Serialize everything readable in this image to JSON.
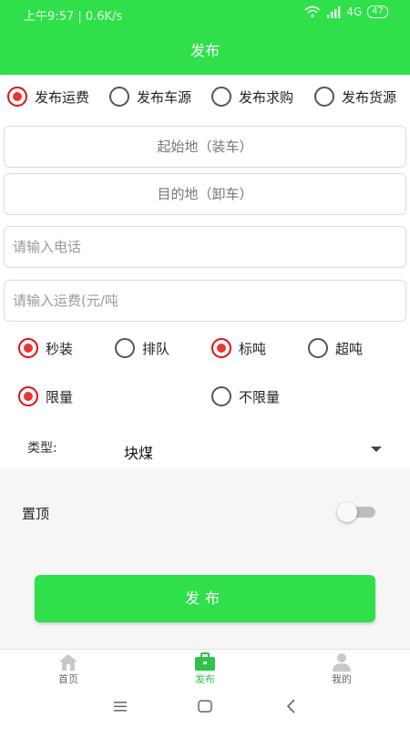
{
  "status": {
    "time_speed": "上午9:57 | 0.6K/s",
    "network": "4G",
    "battery": "47"
  },
  "header": {
    "title": "发布"
  },
  "publish_types": [
    {
      "label": "发布运费",
      "checked": true
    },
    {
      "label": "发布车源",
      "checked": false
    },
    {
      "label": "发布求购",
      "checked": false
    },
    {
      "label": "发布货源",
      "checked": false
    }
  ],
  "fields": {
    "origin_placeholder": "起始地（装车）",
    "destination_placeholder": "目的地（卸车）",
    "phone_placeholder": "请输入电话",
    "freight_placeholder": "请输入运费(元/吨"
  },
  "options_row1": [
    {
      "label": "秒装",
      "checked": true
    },
    {
      "label": "排队",
      "checked": false
    },
    {
      "label": "标吨",
      "checked": true
    },
    {
      "label": "超吨",
      "checked": false
    }
  ],
  "options_row2": [
    {
      "label": "限量",
      "checked": true
    },
    {
      "label": "不限量",
      "checked": false
    }
  ],
  "type_select": {
    "label": "类型:",
    "value": "块煤"
  },
  "pin_top": {
    "label": "置顶",
    "on": false
  },
  "submit": {
    "label": "发布"
  },
  "tabbar": [
    {
      "label": "首页",
      "icon": "home-icon",
      "active": false
    },
    {
      "label": "发布",
      "icon": "briefcase-icon",
      "active": true
    },
    {
      "label": "我的",
      "icon": "user-icon",
      "active": false
    }
  ],
  "colors": {
    "primary": "#2fe04b",
    "radio_checked": "#e33333"
  }
}
